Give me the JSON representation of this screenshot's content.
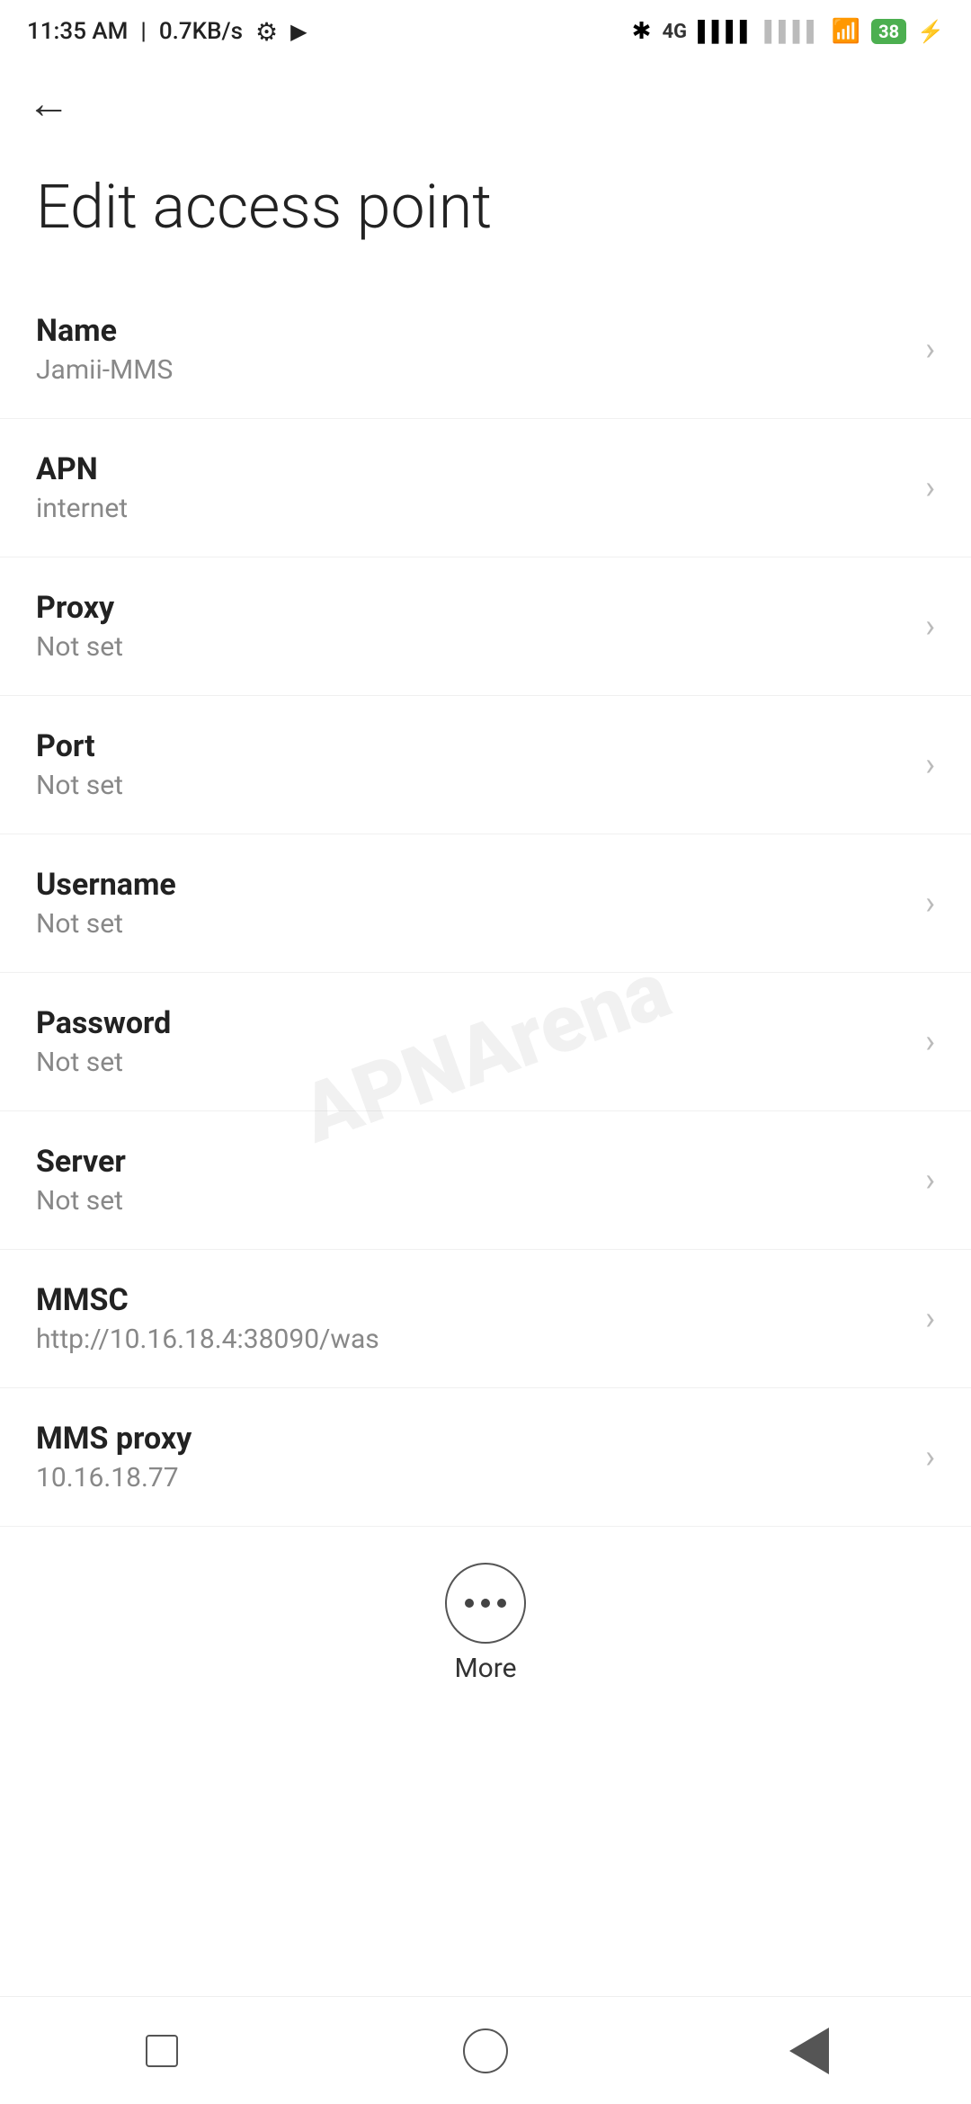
{
  "statusBar": {
    "time": "11:35 AM",
    "speed": "0.7KB/s",
    "battery": "38"
  },
  "toolbar": {
    "backLabel": "←"
  },
  "pageTitle": "Edit access point",
  "settings": [
    {
      "label": "Name",
      "value": "Jamii-MMS"
    },
    {
      "label": "APN",
      "value": "internet"
    },
    {
      "label": "Proxy",
      "value": "Not set"
    },
    {
      "label": "Port",
      "value": "Not set"
    },
    {
      "label": "Username",
      "value": "Not set"
    },
    {
      "label": "Password",
      "value": "Not set"
    },
    {
      "label": "Server",
      "value": "Not set"
    },
    {
      "label": "MMSC",
      "value": "http://10.16.18.4:38090/was"
    },
    {
      "label": "MMS proxy",
      "value": "10.16.18.77"
    }
  ],
  "moreButton": {
    "label": "More"
  },
  "watermark": "APNArena",
  "navBar": {
    "square": "",
    "circle": "",
    "back": ""
  }
}
